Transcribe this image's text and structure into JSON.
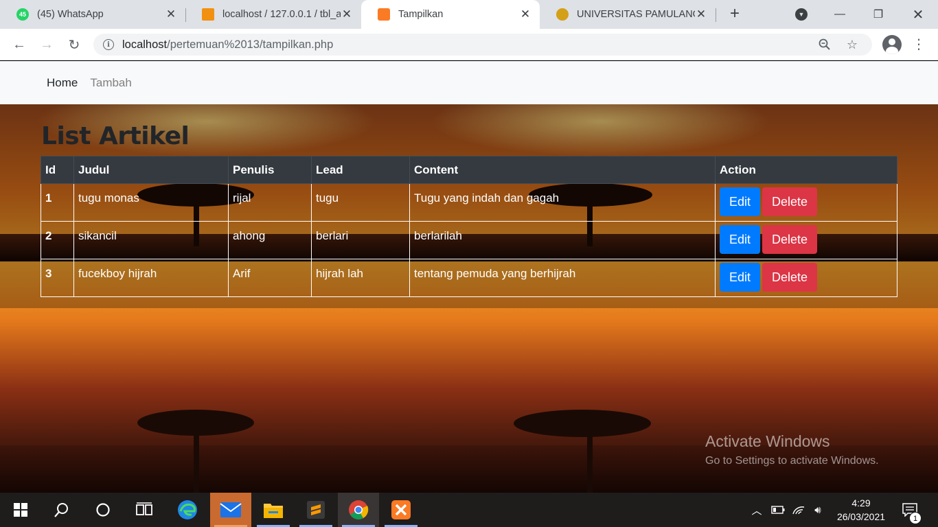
{
  "browser": {
    "tabs": [
      {
        "title": "(45) WhatsApp",
        "badge": "45",
        "favicon_color": "#25d366"
      },
      {
        "title": "localhost / 127.0.0.1 / tbl_a",
        "favicon_color": "#f29111"
      },
      {
        "title": "Tampilkan",
        "favicon_color": "#fb7a24",
        "active": true
      },
      {
        "title": "UNIVERSITAS PAMULANG",
        "favicon_color": "#d4a017"
      }
    ],
    "url_host": "localhost",
    "url_path": "/pertemuan%2013/tampilkan.php"
  },
  "navbar": {
    "home": "Home",
    "tambah": "Tambah"
  },
  "page": {
    "title": "List Artikel",
    "columns": [
      "Id",
      "Judul",
      "Penulis",
      "Lead",
      "Content",
      "Action"
    ],
    "rows": [
      {
        "id": "1",
        "judul": "tugu monas",
        "penulis": "rijal",
        "lead": "tugu",
        "content": "Tugu yang indah dan gagah"
      },
      {
        "id": "2",
        "judul": "sikancil",
        "penulis": "ahong",
        "lead": "berlari",
        "content": "berlarilah"
      },
      {
        "id": "3",
        "judul": "fucekboy hijrah",
        "penulis": "Arif",
        "lead": "hijrah lah",
        "content": "tentang pemuda yang berhijrah"
      }
    ],
    "edit_label": "Edit",
    "delete_label": "Delete"
  },
  "watermark": {
    "title": "Activate Windows",
    "subtitle": "Go to Settings to activate Windows."
  },
  "taskbar": {
    "time": "4:29",
    "date": "26/03/2021",
    "notification_count": "1"
  }
}
